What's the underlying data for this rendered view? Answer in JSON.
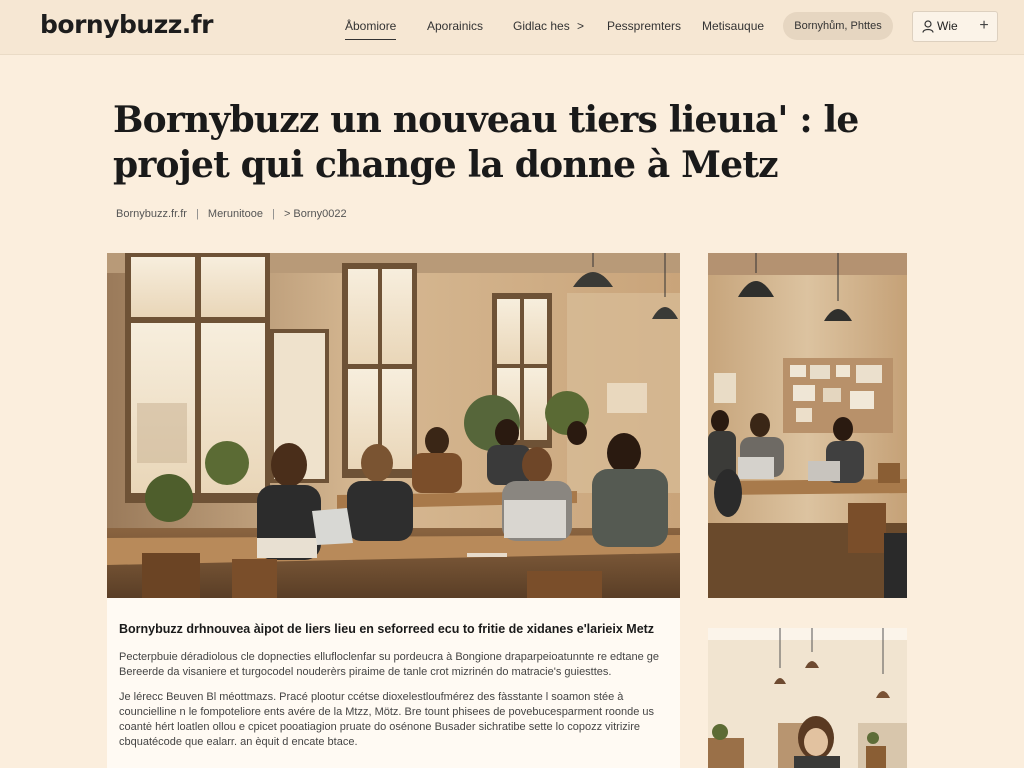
{
  "header": {
    "logo": "bornybuzz.fr",
    "nav": [
      "Åbomiore",
      "Aporainics",
      "Gidlac hes",
      "Pesspremters",
      "Metisauque"
    ],
    "nav_chevron": ">",
    "cta": "Bornyhům, Phttes",
    "user_label": "Wie",
    "plus": "+"
  },
  "article": {
    "title_line1": "Bornybuzz un  nouveau tiers lieuıa' : le",
    "title_line2": " projet qui change la donne à Metz",
    "breadcrumb": [
      "Bornybuzz.fr.fr",
      "Merunitooe",
      "> Borny0022"
    ],
    "breadcrumb_sep": "|",
    "lead": "Bornybuzz drhnouvea àipot de liers lieu en seforreed ecu to fritie de xidanes e'larieix Metz",
    "para1": "Pecterpbuie déradiolous cle dopnecties ellufloclenfar su pordeucra à Bongione draparpeioatunnte re edtane ge Bereerde da visaniere et turgocodel nouderèrs piraime de tanle crot mizrinén do matracie's guiesttes.",
    "para2": "Je lérecc Beuven Bl méottmazs. Pracé plootur ccétse dioxelestloufmérez des fàsstante l soamon stée à councielline n le fompoteliore ents avére de la Mtzz, Mötz. Bre tount phisees de povebucesparment roonde us coantė hért loatlen ollou e cpicet pooatiagion pruate do osénone Busader sichratibe sette lo copozz vitrizire cbquatécode que ealarr. an èquit d encate btace."
  }
}
